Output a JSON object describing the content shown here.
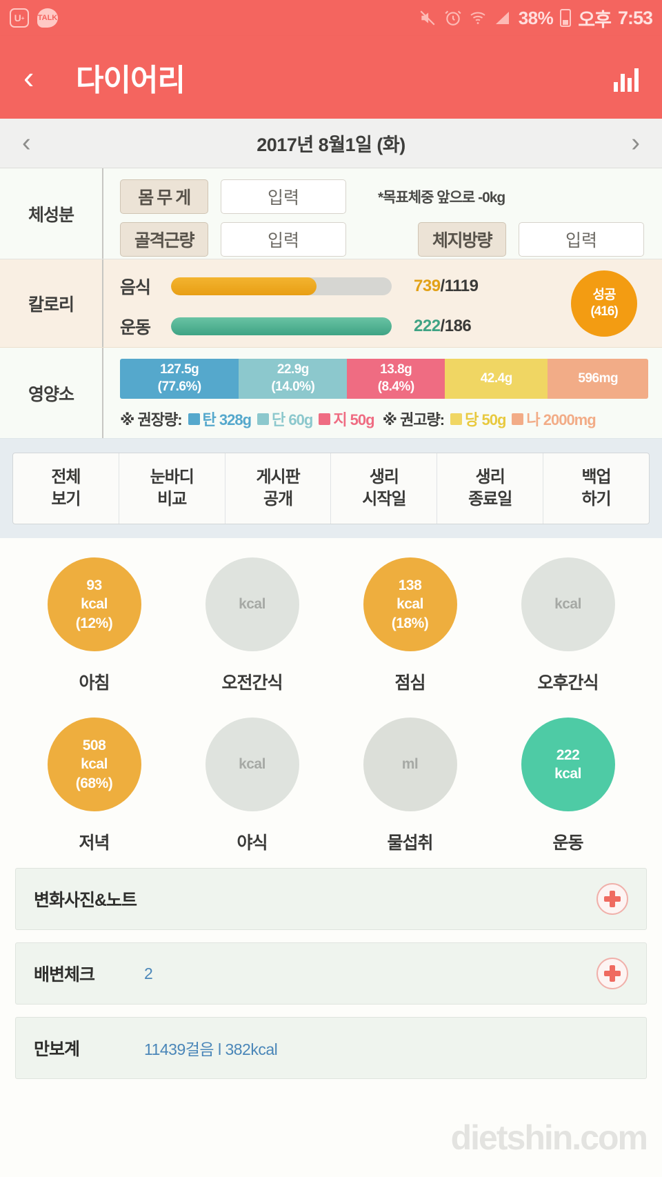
{
  "status_bar": {
    "left_icons": [
      "u-plus-icon",
      "kakaotalk-icon"
    ],
    "right_icons": [
      "mute-vibrate-icon",
      "alarm-icon",
      "wifi-icon",
      "signal-icon"
    ],
    "battery_percent": "38%",
    "time_period": "오후",
    "time": "7:53"
  },
  "header": {
    "back_label": "‹",
    "title": "다이어리",
    "chart_icon": "bar-chart-icon"
  },
  "date_bar": {
    "prev": "‹",
    "date": "2017년 8월1일 (화)",
    "next": "›"
  },
  "body_composition": {
    "label": "체성분",
    "rows": [
      {
        "name": "몸 무 게",
        "value": "입력"
      },
      {
        "name": "골격근량",
        "value": "입력"
      },
      {
        "name": "체지방량",
        "value": "입력"
      }
    ],
    "goal_note": "*목표체중 앞으로 -0kg"
  },
  "calories": {
    "label": "칼로리",
    "food": {
      "name": "음식",
      "current": "739",
      "separator": "/",
      "target": "1119",
      "percent": 66,
      "color": "#e89e14"
    },
    "exercise": {
      "name": "운동",
      "current": "222",
      "separator": "/",
      "target": "186",
      "percent": 100,
      "color": "#3fa384"
    },
    "badge": {
      "title": "성공",
      "value": "(416)",
      "color": "#f39c12"
    }
  },
  "nutrients": {
    "label": "영양소",
    "cells": [
      {
        "name": "탄수화물",
        "amount": "127.5g",
        "percent": "(77.6%)",
        "color": "#55a8cc",
        "width": 22.5
      },
      {
        "name": "단백질",
        "amount": "22.9g",
        "percent": "(14.0%)",
        "color": "#8cc8cd",
        "width": 20.5
      },
      {
        "name": "지방",
        "amount": "13.8g",
        "percent": "(8.4%)",
        "color": "#ef6c82",
        "width": 18.5
      },
      {
        "name": "당",
        "amount": "42.4g",
        "percent": "",
        "color": "#f0d663",
        "width": 19.5
      },
      {
        "name": "나트륨",
        "amount": "596mg",
        "percent": "",
        "color": "#f2ac87",
        "width": 19.0
      }
    ],
    "legend": {
      "rec_label": "※ 권장량:",
      "adv_label": "※ 권고량:",
      "recommended": [
        {
          "swatch": "#55a8cc",
          "text": "탄 328g",
          "color": "#55a8cc"
        },
        {
          "swatch": "#8cc8cd",
          "text": "단 60g",
          "color": "#8cc8cd"
        },
        {
          "swatch": "#ef6c82",
          "text": "지 50g",
          "color": "#ef6c82"
        }
      ],
      "advised": [
        {
          "swatch": "#f0d663",
          "text": "당 50g",
          "color": "#e8c93f"
        },
        {
          "swatch": "#f2ac87",
          "text": "나 2000mg",
          "color": "#f2ac87"
        }
      ]
    }
  },
  "tabs": [
    {
      "line1": "전체",
      "line2": "보기"
    },
    {
      "line1": "눈바디",
      "line2": "비교"
    },
    {
      "line1": "게시판",
      "line2": "공개"
    },
    {
      "line1": "생리",
      "line2": "시작일"
    },
    {
      "line1": "생리",
      "line2": "종료일"
    },
    {
      "line1": "백업",
      "line2": "하기"
    }
  ],
  "meals": {
    "row1": [
      {
        "label": "아침",
        "value": "93",
        "unit": "kcal",
        "percent": "(12%)",
        "state": "filled-o"
      },
      {
        "label": "오전간식",
        "value": "",
        "unit": "kcal",
        "percent": "",
        "state": "empty"
      },
      {
        "label": "점심",
        "value": "138",
        "unit": "kcal",
        "percent": "(18%)",
        "state": "filled-o"
      },
      {
        "label": "오후간식",
        "value": "",
        "unit": "kcal",
        "percent": "",
        "state": "empty"
      }
    ],
    "row2": [
      {
        "label": "저녁",
        "value": "508",
        "unit": "kcal",
        "percent": "(68%)",
        "state": "filled-o"
      },
      {
        "label": "야식",
        "value": "",
        "unit": "kcal",
        "percent": "",
        "state": "empty"
      },
      {
        "label": "물섭취",
        "value": "",
        "unit": "ml",
        "percent": "",
        "state": "empty2"
      },
      {
        "label": "운동",
        "value": "222",
        "unit": "kcal",
        "percent": "",
        "state": "filled-g"
      }
    ]
  },
  "bottom_rows": [
    {
      "label": "변화사진&노트",
      "value": "",
      "add_icon": "plus-icon"
    },
    {
      "label": "배변체크",
      "value": "2",
      "add_icon": "plus-icon"
    },
    {
      "label": "만보계",
      "value": "11439걸음 l 382kcal",
      "add_icon": ""
    }
  ],
  "watermark": "dietshin.com"
}
